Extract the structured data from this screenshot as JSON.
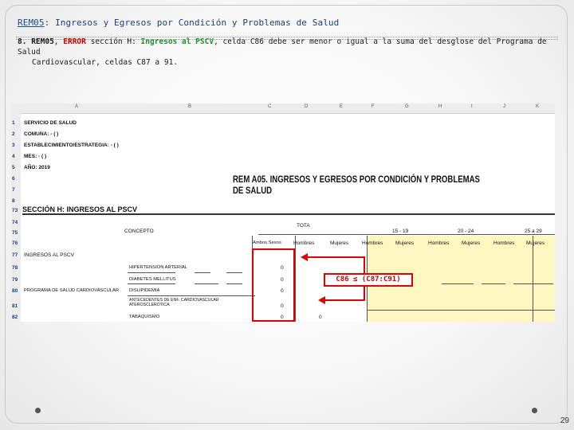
{
  "slide": {
    "title_link": "REM05",
    "title_rest": ": Ingresos y Egresos por Condición y Problemas de Salud",
    "item_num": "8.",
    "item_code": "REM05",
    "item_sep": ",",
    "item_error": "ERROR",
    "item_section": "sección H:",
    "item_green": "Ingresos al PSCV",
    "item_rest": ", celda C86 debe ser menor o igual a la suma del desglose del Programa de Salud",
    "item_line2": "Cardiovascular, celdas C87 a 91.",
    "page_number": "29"
  },
  "sheet": {
    "col_headers": [
      "A",
      "B",
      "C",
      "D",
      "E",
      "F",
      "G",
      "H",
      "I",
      "J",
      "K"
    ],
    "rows": [
      {
        "num": "1",
        "text": "SERVICIO DE SALUD"
      },
      {
        "num": "2",
        "text": "COMUNA:  - ( )"
      },
      {
        "num": "3",
        "text": "ESTABLECIMIENTO/ESTRATEGIA:  - ( )"
      },
      {
        "num": "4",
        "text": "MES:  - ( )"
      },
      {
        "num": "5",
        "text": "AÑO: 2019"
      },
      {
        "num": "6",
        "text": ""
      },
      {
        "num": "7",
        "text": ""
      },
      {
        "num": "8",
        "text": ""
      }
    ],
    "report_title": "REM A05.  INGRESOS Y EGRESOS POR CONDICIÓN Y PROBLEMAS DE SALUD",
    "section_row": "73",
    "section_title": "SECCIÓN H: INGRESOS AL PSCV",
    "lower_rows": [
      "74",
      "75",
      "76",
      "77",
      "78",
      "79",
      "80",
      "81",
      "82"
    ],
    "concepto": "CONCEPTO",
    "total_label": "TOTA",
    "age_groups": [
      "15 - 19",
      "20 - 24",
      "25 a 29"
    ],
    "sub_headers": [
      "Ambos Sexos",
      "Hombres",
      "Mujeres",
      "Hombres",
      "Mujeres",
      "Hombres",
      "Mujeres",
      "Hombres",
      "Mujeres"
    ],
    "ingresos": "INGRESOS AL PSCV",
    "programa": "PROGRAMA DE SALUD CARDIOVASCULAR",
    "conditions": [
      "HIPERTENSIÓN ARTERIAL",
      "DIABETES MELLITUS",
      "DISLIPIDEMIA",
      "ANTECEDENTES DE ENF. CARDIOVASCULAR ATEROSCLERÓTICA",
      "TABAQUISMO"
    ],
    "values": [
      "0",
      "0",
      "0",
      "0",
      "0",
      "0"
    ],
    "formula": "C86 ≤ (C87:C91)"
  }
}
